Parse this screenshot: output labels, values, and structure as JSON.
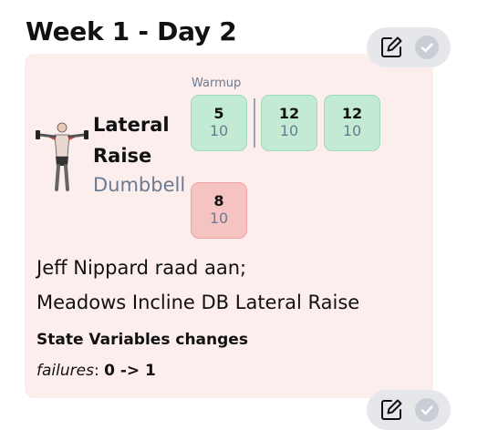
{
  "header": {
    "title": "Week 1 - Day 2"
  },
  "exercise": {
    "name_line1": "Lateral",
    "name_line2": "Raise",
    "equipment": "Dumbbell",
    "warmup_label": "Warmup",
    "sets": [
      {
        "reps": "5",
        "weight": "10",
        "status": "completed",
        "color": "#c3ebd3"
      },
      {
        "reps": "12",
        "weight": "10",
        "status": "completed",
        "color": "#c3ebd3"
      },
      {
        "reps": "12",
        "weight": "10",
        "status": "completed",
        "color": "#c3ebd3"
      },
      {
        "reps": "8",
        "weight": "10",
        "status": "failed",
        "color": "#f6c3c3"
      }
    ],
    "notes": [
      "Jeff Nippard raad aan;",
      "Meadows Incline DB Lateral Raise"
    ],
    "state_variables": {
      "title": "State Variables changes",
      "variable": "failures",
      "separator": ": ",
      "change": "0 -> 1"
    }
  },
  "actions": {
    "edit_icon": "edit-icon",
    "check_icon": "check-circle-icon"
  },
  "colors": {
    "card_bg": "#fdeeee",
    "accent_muted": "#6b7a90",
    "pill_bg": "#e5e7eb"
  }
}
